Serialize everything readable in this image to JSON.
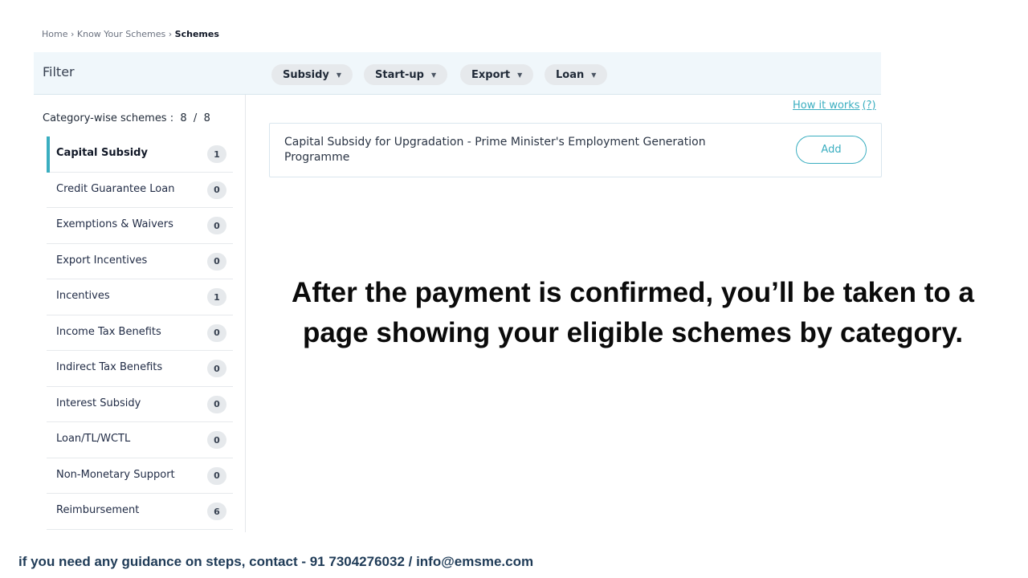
{
  "breadcrumb": {
    "items": [
      "Home",
      "Know Your Schemes",
      "Schemes"
    ]
  },
  "filter": {
    "title": "Filter",
    "chips": [
      {
        "label": "Subsidy"
      },
      {
        "label": "Start-up"
      },
      {
        "label": "Export"
      },
      {
        "label": "Loan"
      }
    ]
  },
  "sidebar": {
    "count_label": "Category-wise schemes :",
    "count_current": "8",
    "count_sep": "/",
    "count_total": "8",
    "categories": [
      {
        "label": "Capital Subsidy",
        "count": "1"
      },
      {
        "label": "Credit Guarantee Loan",
        "count": "0"
      },
      {
        "label": "Exemptions & Waivers",
        "count": "0"
      },
      {
        "label": "Export Incentives",
        "count": "0"
      },
      {
        "label": "Incentives",
        "count": "1"
      },
      {
        "label": "Income Tax Benefits",
        "count": "0"
      },
      {
        "label": "Indirect Tax Benefits",
        "count": "0"
      },
      {
        "label": "Interest Subsidy",
        "count": "0"
      },
      {
        "label": "Loan/TL/WCTL",
        "count": "0"
      },
      {
        "label": "Non-Monetary Support",
        "count": "0"
      },
      {
        "label": "Reimbursement",
        "count": "6"
      }
    ]
  },
  "main": {
    "how_it_works": "How it works",
    "how_it_works_q": "(?)",
    "scheme": {
      "title": "Capital Subsidy for Upgradation - Prime Minister's Employment Generation Programme",
      "add_label": "Add"
    }
  },
  "caption": "After the payment is confirmed, you’ll be taken to a page showing your eligible schemes by category.",
  "footer": "if you need any guidance on steps, contact - 91 7304276032 / info@emsme.com",
  "colors": {
    "accent": "#3aaec0",
    "filter_bg": "#f0f7fb",
    "chip_bg": "#e6e9ec"
  }
}
